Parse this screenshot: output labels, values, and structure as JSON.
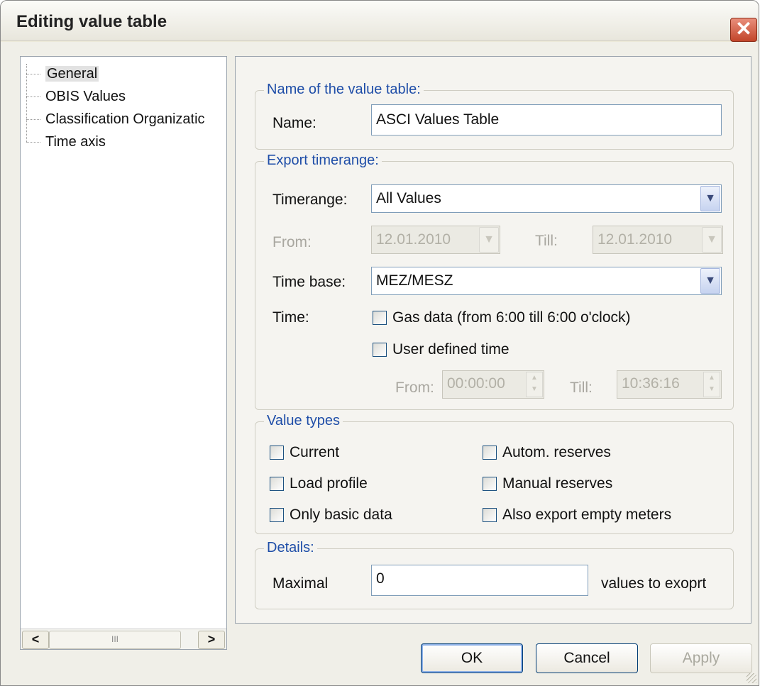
{
  "window": {
    "title": "Editing value table",
    "close_symbol": "✕"
  },
  "tree": {
    "items": [
      {
        "label": "General",
        "selected": true
      },
      {
        "label": "OBIS Values",
        "selected": false
      },
      {
        "label": "Classification Organizatic",
        "selected": false
      },
      {
        "label": "Time axis",
        "selected": false
      }
    ],
    "scroll_left": "<",
    "scroll_right": ">",
    "scroll_thumb_grip": "III"
  },
  "name_group": {
    "legend": "Name of the value table:",
    "name_label": "Name:",
    "name_value": "ASCI Values Table"
  },
  "export_group": {
    "legend": "Export timerange:",
    "timerange_label": "Timerange:",
    "timerange_value": "All Values",
    "from_label": "From:",
    "from_date": "12.01.2010",
    "till_label": "Till:",
    "till_date": "12.01.2010",
    "timebase_label": "Time base:",
    "timebase_value": "MEZ/MESZ",
    "time_label": "Time:",
    "gas_data_label": "Gas data (from 6:00 till 6:00 o'clock)",
    "user_defined_label": "User defined time",
    "time_from_label": "From:",
    "time_from_value": "00:00:00",
    "time_till_label": "Till:",
    "time_till_value": "10:36:16"
  },
  "value_types": {
    "legend": "Value types",
    "current": "Current",
    "load_profile": "Load profile",
    "only_basic": "Only basic data",
    "autom_reserves": "Autom. reserves",
    "manual_reserves": "Manual reserves",
    "export_empty": "Also export empty meters"
  },
  "details": {
    "legend": "Details:",
    "maximal_label": "Maximal",
    "maximal_value": "0",
    "suffix": "values to exoprt"
  },
  "buttons": {
    "ok": "OK",
    "cancel": "Cancel",
    "apply": "Apply"
  },
  "icons": {
    "dropdown": "chevron-down-icon",
    "spin": "spin-arrows-icon",
    "close": "close-icon"
  }
}
